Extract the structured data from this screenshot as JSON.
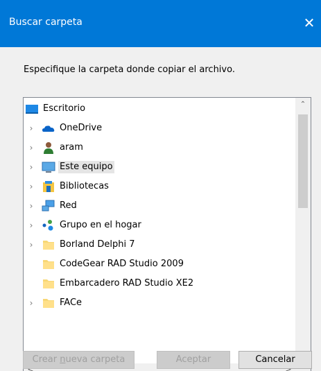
{
  "window": {
    "title": "Buscar carpeta",
    "close_glyph": "✕"
  },
  "instruction": "Especifique la carpeta donde copiar el archivo.",
  "tree": {
    "items": [
      {
        "label": "Escritorio",
        "icon": "desktop-icon",
        "expandable": false,
        "selected": false
      },
      {
        "label": "OneDrive",
        "icon": "onedrive-cloud-icon",
        "expandable": true,
        "selected": false
      },
      {
        "label": "aram",
        "icon": "user-icon",
        "expandable": true,
        "selected": false
      },
      {
        "label": "Este equipo",
        "icon": "computer-icon",
        "expandable": true,
        "selected": true
      },
      {
        "label": "Bibliotecas",
        "icon": "libraries-icon",
        "expandable": true,
        "selected": false
      },
      {
        "label": "Red",
        "icon": "network-icon",
        "expandable": true,
        "selected": false
      },
      {
        "label": "Grupo en el hogar",
        "icon": "homegroup-icon",
        "expandable": true,
        "selected": false
      },
      {
        "label": "Borland Delphi 7",
        "icon": "folder-icon",
        "expandable": true,
        "selected": false
      },
      {
        "label": "CodeGear RAD Studio 2009",
        "icon": "folder-icon",
        "expandable": false,
        "selected": false
      },
      {
        "label": "Embarcadero RAD Studio XE2",
        "icon": "folder-icon",
        "expandable": false,
        "selected": false
      },
      {
        "label": "FACe",
        "icon": "folder-icon",
        "expandable": true,
        "selected": false
      }
    ],
    "expand_glyph": "›",
    "scroll_up": "⌃",
    "scroll_down": "⌄",
    "scroll_left": "<",
    "scroll_right": ">",
    "vertical_scroll_fraction": 0.0
  },
  "buttons": {
    "new_folder_pre": "Crear ",
    "new_folder_u": "n",
    "new_folder_post": "ueva carpeta",
    "accept": "Aceptar",
    "cancel": "Cancelar"
  },
  "colors": {
    "title_bar": "#0078d7",
    "selection": "#e5e5e5",
    "folder": "#f8d775"
  }
}
